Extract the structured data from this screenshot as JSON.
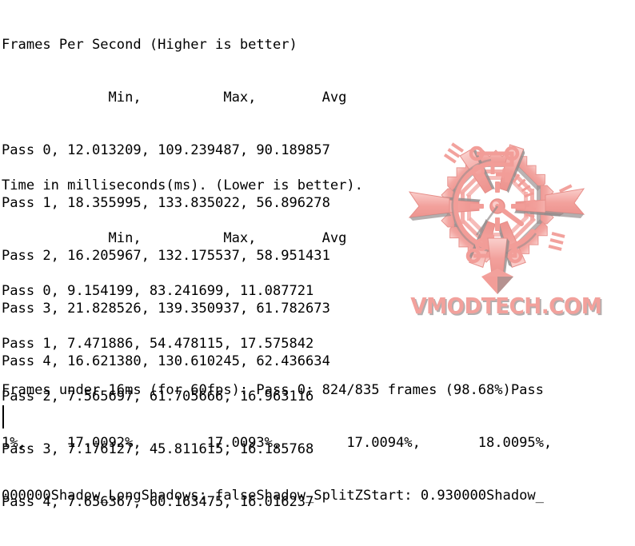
{
  "terminal": {
    "background_color": "#ffffff",
    "text_color": "#000000",
    "fps_section": {
      "title": "Frames Per Second (Higher is better)",
      "header": "             Min,          Max,        Avg",
      "rows": [
        "Pass 0, 12.013209, 109.239487, 90.189857",
        "Pass 1, 18.355995, 133.835022, 56.896278",
        "Pass 2, 16.205967, 132.175537, 58.951431",
        "Pass 3, 21.828526, 139.350937, 61.782673",
        "Pass 4, 16.621380, 130.610245, 62.436634"
      ]
    },
    "ms_section": {
      "title": "Time in milliseconds(ms). (Lower is better).",
      "header": "             Min,          Max,        Avg",
      "rows": [
        "Pass 0, 9.154199, 83.241699, 11.087721",
        "Pass 1, 7.471886, 54.478115, 17.575842",
        "Pass 2, 7.565697, 61.705666, 16.963116",
        "Pass 3, 7.176127, 45.811615, 16.185768",
        "Pass 4, 7.656367, 60.163475, 16.016237"
      ]
    },
    "extra_section": {
      "lines": [
        "Frames under 16ms (for 60fps): Pass 0: 824/835 frames (98.68%)Pass",
        "1%,     17.0092%,        17.0093%,        17.0094%,       18.0095%,",
        "000000Shadow_LongShadows: falseShadow_SplitZStart: 0.930000Shadow_"
      ]
    },
    "caret_visible": true
  },
  "watermark": {
    "brand_text": "VMODTECH.COM",
    "emblem_name": "aztec-sun-emblem",
    "primary_color": "#f08a84",
    "shadow_color": "#7a7070",
    "highlight_color": "#f9c4c0"
  }
}
